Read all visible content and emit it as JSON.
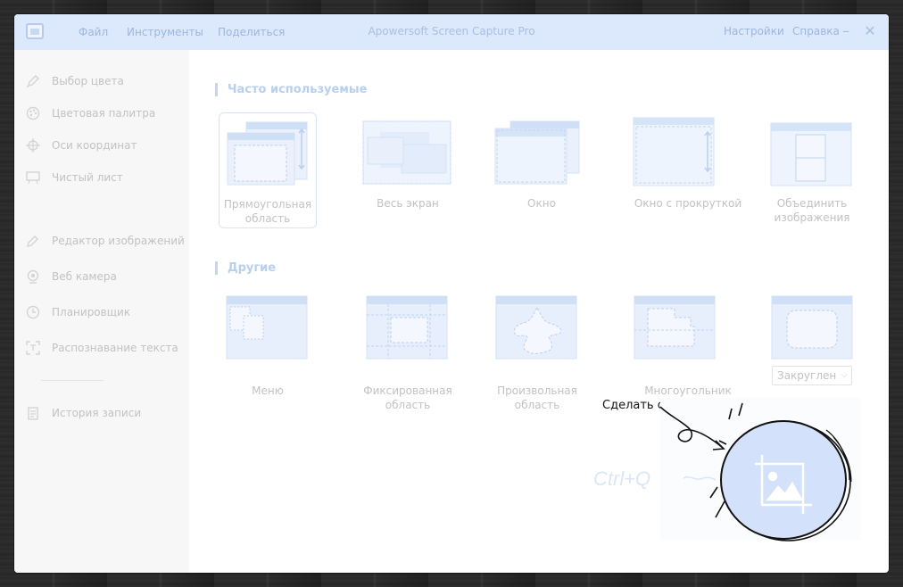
{
  "window": {
    "title": "Apowersoft Screen Capture Pro",
    "menu": [
      "Файл",
      "Инструменты",
      "Поделиться"
    ],
    "right_menu": [
      "Настройки",
      "Справка"
    ],
    "accent": "#dce8fb"
  },
  "sidebar": {
    "items": [
      {
        "label": "Выбор цвета",
        "icon": "pencil-icon"
      },
      {
        "label": "Цветовая палитра",
        "icon": "palette-icon"
      },
      {
        "label": "Оси координат",
        "icon": "crosshair-icon"
      },
      {
        "label": "Чистый лист",
        "icon": "whiteboard-icon"
      },
      {
        "label": "Редактор изображений",
        "icon": "edit-pencil-icon"
      },
      {
        "label": "Веб камера",
        "icon": "webcam-icon"
      },
      {
        "label": "Планировщик",
        "icon": "clock-icon"
      },
      {
        "label": "Распознавание текста",
        "icon": "ocr-icon"
      },
      {
        "label": "История записи",
        "icon": "history-icon"
      }
    ]
  },
  "sections": {
    "frequent": {
      "title": "Часто используемые",
      "tiles": [
        {
          "lines": [
            "Прямоугольная",
            "область"
          ],
          "icon": "region-capture-icon",
          "selected": true
        },
        {
          "lines": [
            "Весь экран"
          ],
          "icon": "fullscreen-capture-icon"
        },
        {
          "lines": [
            "Окно"
          ],
          "icon": "window-capture-icon"
        },
        {
          "lines": [
            "Окно с прокруткой"
          ],
          "icon": "scrolling-window-icon"
        },
        {
          "lines": [
            "Объединить",
            "изображения"
          ],
          "icon": "merge-images-icon"
        }
      ]
    },
    "other": {
      "title": "Другие",
      "tiles": [
        {
          "lines": [
            "Меню"
          ],
          "icon": "menu-capture-icon"
        },
        {
          "lines": [
            "Фиксированная",
            "область"
          ],
          "icon": "fixed-region-icon"
        },
        {
          "lines": [
            "Произвольная",
            "область"
          ],
          "icon": "freehand-region-icon"
        },
        {
          "lines": [
            "Многоугольник"
          ],
          "icon": "polygon-region-icon"
        },
        {
          "lines": [],
          "icon": "rounded-region-icon"
        }
      ],
      "shape_select": "Закруглен"
    }
  },
  "capture": {
    "label": "Сделать скриншот",
    "hotkey": "Ctrl+Q",
    "icon": "crop-image-icon"
  }
}
